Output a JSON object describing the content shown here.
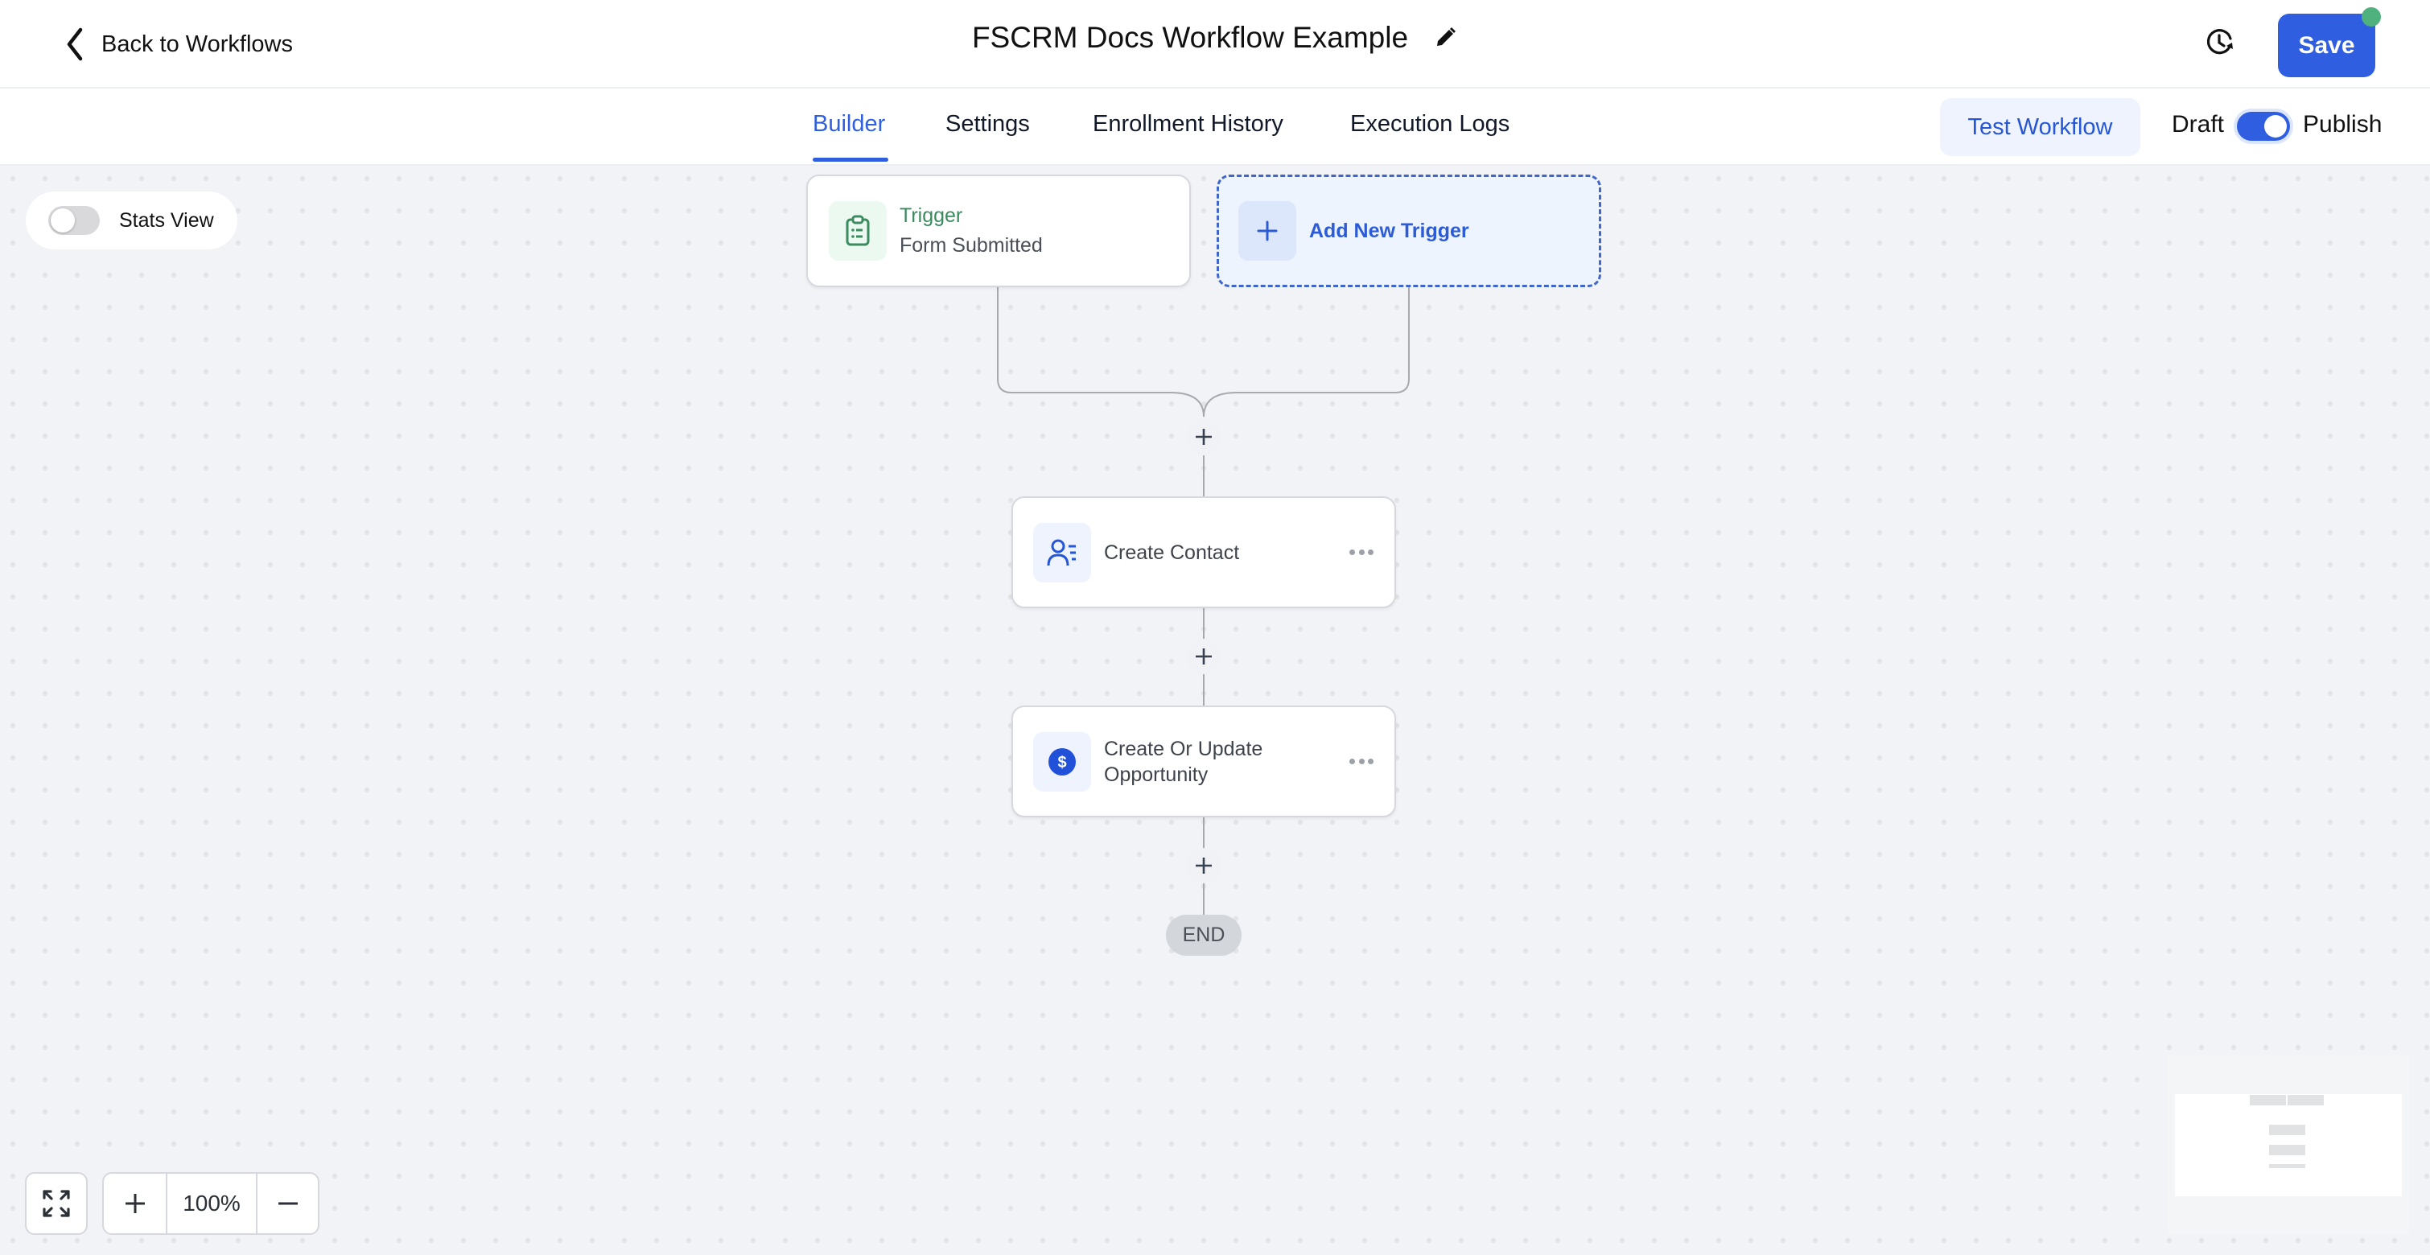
{
  "header": {
    "back_label": "Back to Workflows",
    "title": "FSCRM Docs Workflow Example",
    "save_label": "Save",
    "icons": {
      "back": "chevron-left-icon",
      "edit": "pencil-icon",
      "history": "clock-history-icon"
    },
    "save_status_color": "#4fb17e"
  },
  "tabs": [
    {
      "label": "Builder",
      "active": true
    },
    {
      "label": "Settings",
      "active": false
    },
    {
      "label": "Enrollment History",
      "active": false
    },
    {
      "label": "Execution Logs",
      "active": false
    }
  ],
  "toolbar": {
    "test_label": "Test Workflow",
    "draft_label": "Draft",
    "publish_label": "Publish",
    "published": true
  },
  "canvas": {
    "stats_view_label": "Stats View",
    "stats_view_on": false,
    "trigger": {
      "type_label": "Trigger",
      "name": "Form Submitted",
      "icon": "clipboard-list-icon"
    },
    "add_trigger_label": "Add New Trigger",
    "actions": [
      {
        "label": "Create Contact",
        "icon": "contact-list-icon"
      },
      {
        "label": "Create Or Update Opportunity",
        "icon": "dollar-circle-icon"
      }
    ],
    "end_label": "END",
    "zoom_level": "100%"
  },
  "colors": {
    "accent": "#2f5fe0",
    "trigger_green": "#3a8b5e",
    "canvas_bg": "#f1f3f7"
  }
}
